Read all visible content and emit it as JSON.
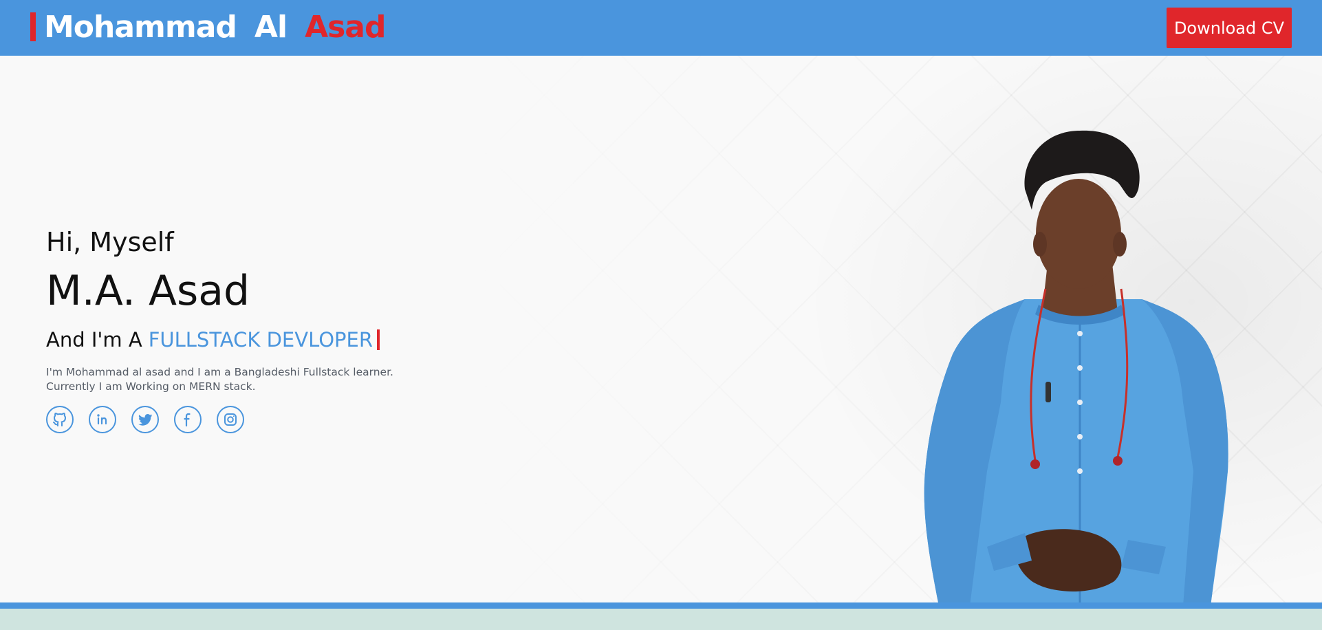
{
  "header": {
    "logo_first": "Mohammad",
    "logo_middle": "Al",
    "logo_last": "Asad",
    "cv_button": "Download CV"
  },
  "hero": {
    "greeting": "Hi, Myself",
    "name": "M.A. Asad",
    "role_prefix": "And I'm A",
    "role_highlight": "FULLSTACK DEVLOPER",
    "bio_line1": "I'm Mohammad al asad and I am a Bangladeshi Fullstack learner.",
    "bio_line2": "Currently I am Working on MERN stack."
  },
  "social_icons": [
    "github-icon",
    "linkedin-icon",
    "twitter-icon",
    "facebook-icon",
    "instagram-icon"
  ],
  "colors": {
    "primary_blue": "#4a95dd",
    "accent_red": "#e0262b",
    "footer_band": "#cfe4df"
  }
}
